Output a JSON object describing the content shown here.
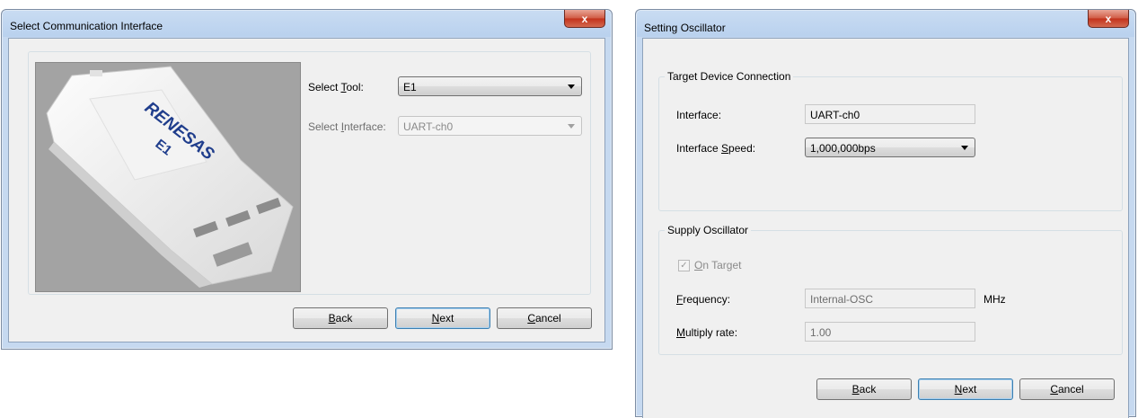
{
  "dialog1": {
    "title": "Select Communication Interface",
    "close": "x",
    "image_brand": "RENESAS",
    "image_model": "E1",
    "tool_label_pre": "Select ",
    "tool_label_key": "T",
    "tool_label_post": "ool:",
    "tool_value": "E1",
    "interface_label_pre": "Select ",
    "interface_label_key": "I",
    "interface_label_post": "nterface:",
    "interface_value": "UART-ch0",
    "back_key": "B",
    "back_rest": "ack",
    "next_key": "N",
    "next_rest": "ext",
    "cancel_key": "C",
    "cancel_rest": "ancel"
  },
  "dialog2": {
    "title": "Setting Oscillator",
    "close": "x",
    "group1": "Target Device Connection",
    "interface_label": "Interface:",
    "interface_value": "UART-ch0",
    "speed_label_pre": "Interface ",
    "speed_label_key": "S",
    "speed_label_post": "peed:",
    "speed_value": "1,000,000bps",
    "group2": "Supply Oscillator",
    "on_target_key": "O",
    "on_target_rest": "n Target",
    "on_target_checked": true,
    "frequency_key": "F",
    "frequency_rest": "requency:",
    "frequency_value": "Internal-OSC",
    "frequency_unit": "MHz",
    "multiply_key": "M",
    "multiply_rest": "ultiply rate:",
    "multiply_value": "1.00",
    "back_key": "B",
    "back_rest": "ack",
    "next_key": "N",
    "next_rest": "ext",
    "cancel_key": "C",
    "cancel_rest": "ancel"
  }
}
